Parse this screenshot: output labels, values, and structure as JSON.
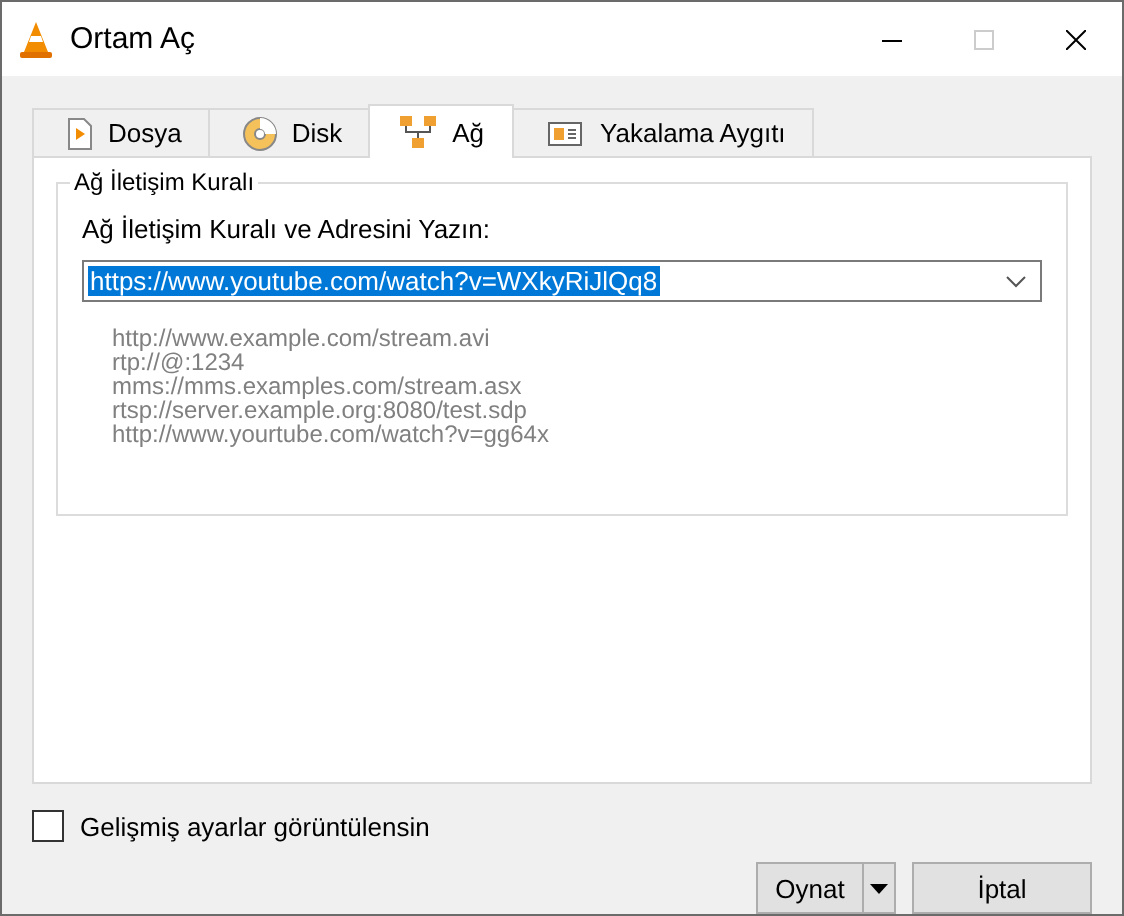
{
  "window": {
    "title": "Ortam Aç"
  },
  "tabs": [
    {
      "label": "Dosya",
      "kind": "file",
      "selected": false
    },
    {
      "label": "Disk",
      "kind": "disc",
      "selected": false
    },
    {
      "label": "Ağ",
      "kind": "network",
      "selected": true
    },
    {
      "label": "Yakalama Aygıtı",
      "kind": "capture",
      "selected": false
    }
  ],
  "group": {
    "title": "Ağ İletişim Kuralı",
    "prompt": "Ağ İletişim Kuralı ve Adresini Yazın:",
    "url": {
      "value": "https://www.youtube.com/watch?v=WXkyRiJlQq8",
      "selected": true
    },
    "examples": [
      "http://www.example.com/stream.avi",
      "rtp://@:1234",
      "mms://mms.examples.com/stream.asx",
      "rtsp://server.example.org:8080/test.sdp",
      "http://www.yourtube.com/watch?v=gg64x"
    ]
  },
  "advanced": {
    "label": "Gelişmiş ayarlar görüntülensin",
    "checked": false
  },
  "buttons": [
    {
      "label": "Oynat",
      "kind": "split"
    },
    {
      "label": "İptal",
      "kind": "plain"
    }
  ]
}
